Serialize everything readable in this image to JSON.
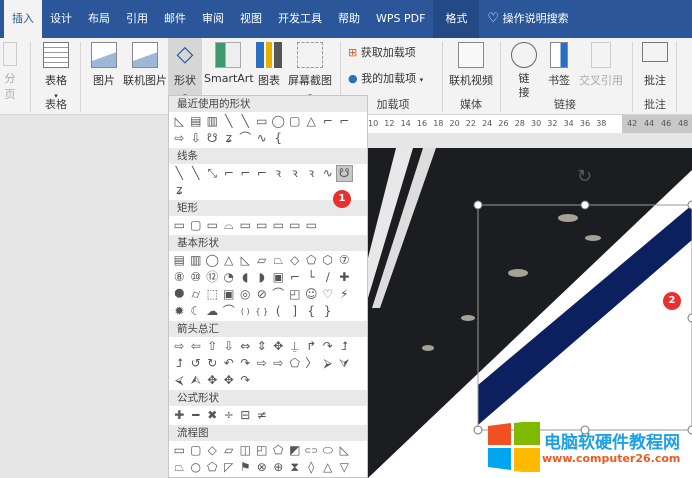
{
  "tabs": [
    "插入",
    "设计",
    "布局",
    "引用",
    "邮件",
    "审阅",
    "视图",
    "开发工具",
    "帮助",
    "WPS PDF",
    "格式"
  ],
  "search": "操作说明搜索",
  "ribbon": {
    "page_btn": "分页",
    "table": "表格",
    "picture": "图片",
    "online_picture": "联机图片",
    "shapes": "形状",
    "smartart": "SmartArt",
    "chart": "图表",
    "screenshot": "屏幕截图",
    "get_addins": "获取加载项",
    "my_addins": "我的加载项",
    "online_video": "联机视频",
    "link": "链接",
    "bookmark": "书签",
    "cross_ref": "交叉引用",
    "comment": "批注",
    "groups": {
      "table": "表格",
      "addins": "加载项",
      "media": "媒体",
      "links": "链接",
      "comments": "批注"
    }
  },
  "shapes_menu": {
    "sections": [
      {
        "title": "最近使用的形状",
        "shapes": [
          "◺",
          "▤",
          "▥",
          "╲",
          "╲",
          "▭",
          "◯",
          "▢",
          "△",
          "⌐",
          "⌐",
          "⇨",
          "⇩",
          "☋",
          "ʑ",
          "⌒",
          "∿",
          "{"
        ]
      },
      {
        "title": "线条",
        "shapes": [
          "╲",
          "╲",
          "⤡",
          "⌐",
          "⌐",
          "⌐",
          "ꝛ",
          "ꝛ",
          "ꝛ",
          "∿",
          "☋",
          "ʑ"
        ],
        "selected": 10
      },
      {
        "title": "矩形",
        "shapes": [
          "▭",
          "▢",
          "▭",
          "⌓",
          "▭",
          "▭",
          "▭",
          "▭",
          "▭"
        ]
      },
      {
        "title": "基本形状",
        "shapes": [
          "▤",
          "▥",
          "◯",
          "△",
          "◺",
          "▱",
          "⏢",
          "◇",
          "⬠",
          "⬡",
          "⑦",
          "⑧",
          "⑩",
          "⑫",
          "◔",
          "◖",
          "◗",
          "▣",
          "⌐",
          "└",
          "∕",
          "✚",
          "⯃",
          "⌭",
          "⬚",
          "▣",
          "◎",
          "⊘",
          "⌒",
          "◰",
          "☺",
          "♡",
          "⚡",
          "✹",
          "☾",
          "☁",
          "⌒",
          "( )",
          "{ }",
          "(",
          "]",
          "{",
          "}"
        ]
      },
      {
        "title": "箭头总汇",
        "shapes": [
          "⇨",
          "⇦",
          "⇧",
          "⇩",
          "⇔",
          "⇕",
          "✥",
          "⍊",
          "↱",
          "↷",
          "⮥",
          "⮥",
          "↺",
          "↻",
          "↶",
          "↷",
          "⇨",
          "⇨",
          "⬠",
          "〉",
          "⮚",
          "⮛",
          "⮘",
          "⮙",
          "✥",
          "✥",
          "↷"
        ]
      },
      {
        "title": "公式形状",
        "shapes": [
          "✚",
          "━",
          "✖",
          "÷",
          "⊟",
          "≠"
        ]
      },
      {
        "title": "流程图",
        "shapes": [
          "▭",
          "▢",
          "◇",
          "▱",
          "◫",
          "◰",
          "⬠",
          "◩",
          "⊂⊃",
          "⬭",
          "◺",
          "⏢",
          "○",
          "⬠",
          "◸",
          "⚑",
          "⊗",
          "⊕",
          "⧗",
          "◊",
          "△",
          "▽",
          "◐",
          "◗",
          "◯",
          "⛀",
          "◍",
          "○"
        ]
      }
    ]
  },
  "ruler": {
    "labels": [
      "10",
      "12",
      "14",
      "16",
      "18",
      "20",
      "22",
      "24",
      "26",
      "28",
      "30",
      "32",
      "34",
      "36",
      "38",
      "42",
      "44",
      "46",
      "48"
    ]
  },
  "badges": [
    "1",
    "2"
  ],
  "watermark": {
    "title": "电脑软硬件教程网",
    "url": "www.computer26.com"
  }
}
